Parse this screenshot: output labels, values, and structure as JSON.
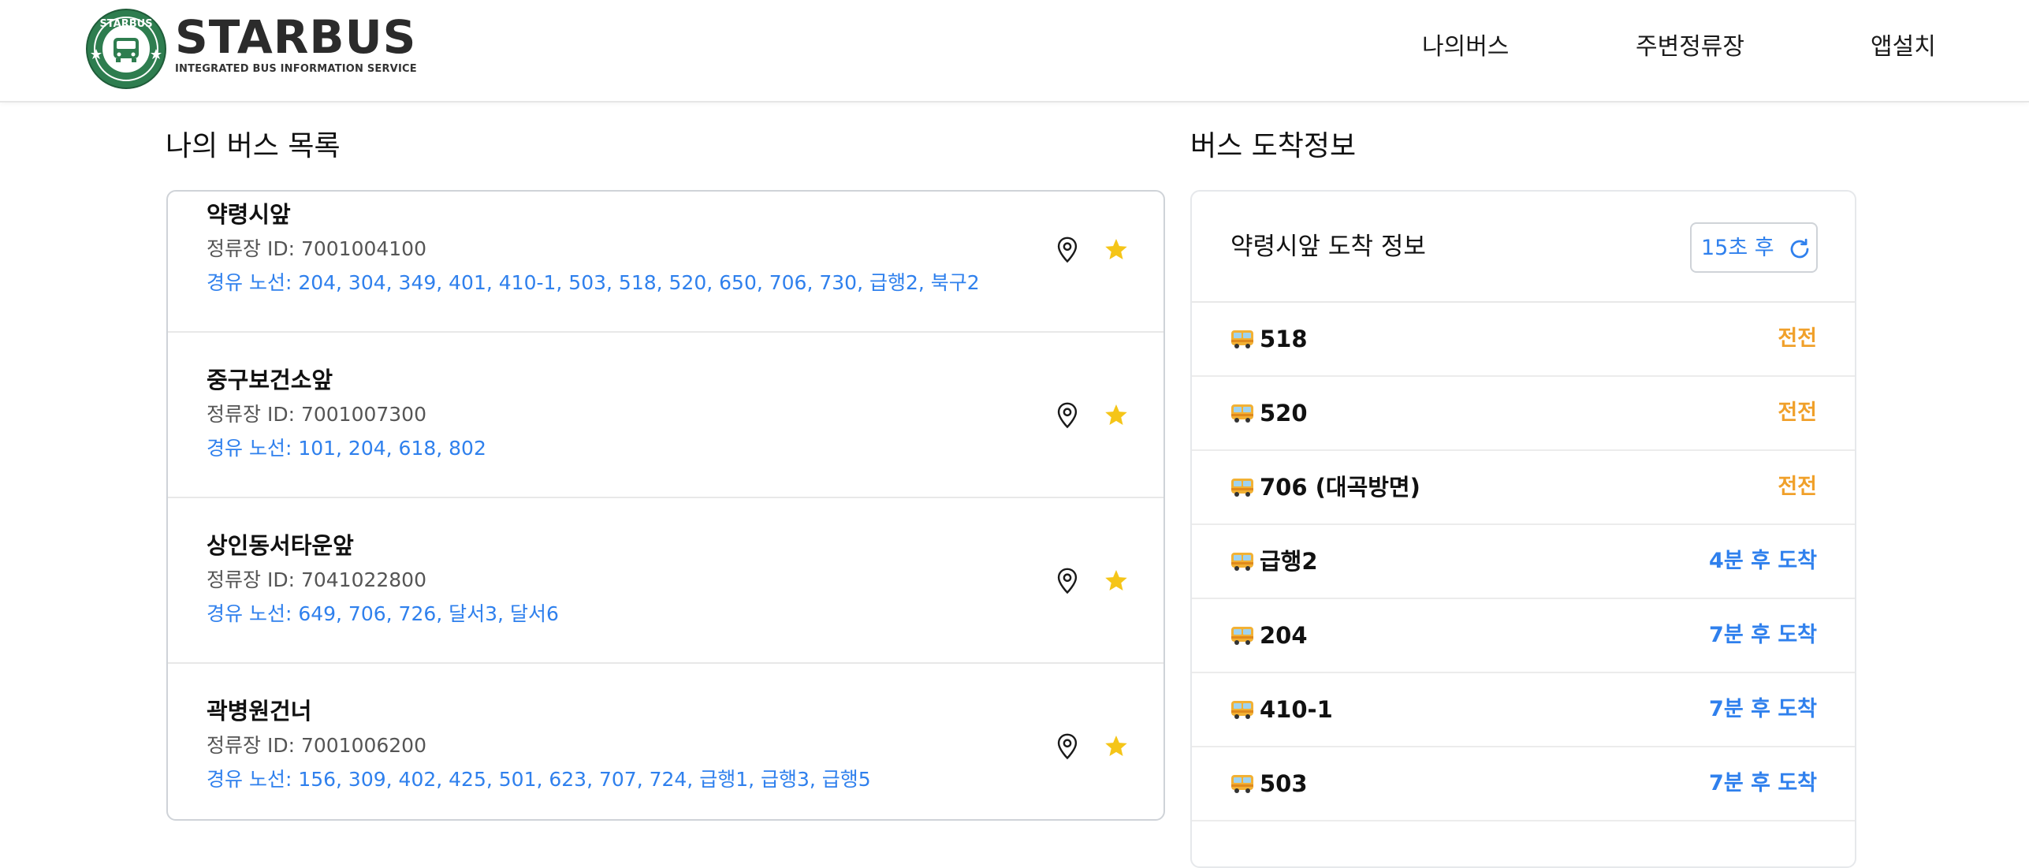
{
  "brand": {
    "name": "STARBUS",
    "tagline": "INTEGRATED BUS INFORMATION SERVICE",
    "logo_text": "STARBUS",
    "primary_color": "#2e7d4f"
  },
  "nav": {
    "items": [
      {
        "label": "나의버스"
      },
      {
        "label": "주변정류장"
      },
      {
        "label": "앱설치"
      }
    ]
  },
  "my_bus_list": {
    "title": "나의 버스 목록",
    "stops": [
      {
        "name": "약령시앞",
        "id_text": "정류장 ID: 7001004100",
        "routes_text": "경유 노선: 204, 304, 349, 401, 410-1, 503, 518, 520, 650, 706, 730, 급행2, 북구2"
      },
      {
        "name": "중구보건소앞",
        "id_text": "정류장 ID: 7001007300",
        "routes_text": "경유 노선: 101, 204, 618, 802"
      },
      {
        "name": "상인동서타운앞",
        "id_text": "정류장 ID: 7041022800",
        "routes_text": "경유 노선: 649, 706, 726, 달서3, 달서6"
      },
      {
        "name": "곽병원건너",
        "id_text": "정류장 ID: 7001006200",
        "routes_text": "경유 노선: 156, 309, 402, 425, 501, 623, 707, 724, 급행1, 급행3, 급행5"
      }
    ],
    "icons": {
      "location": "location-pin-icon",
      "favorite": "star-icon"
    },
    "star_color": "#f5c518"
  },
  "arrival_info": {
    "section_title": "버스 도착정보",
    "card_title": "약령시앞 도착 정보",
    "refresh_label": "15초 후",
    "refresh_icon": "refresh-icon",
    "soon_color": "#f0a02a",
    "later_color": "#2f80ed",
    "rows": [
      {
        "bus": "518",
        "status": "전전",
        "kind": "soon"
      },
      {
        "bus": "520",
        "status": "전전",
        "kind": "soon"
      },
      {
        "bus": "706 (대곡방면)",
        "status": "전전",
        "kind": "soon"
      },
      {
        "bus": "급행2",
        "status": "4분 후 도착",
        "kind": "later"
      },
      {
        "bus": "204",
        "status": "7분 후 도착",
        "kind": "later"
      },
      {
        "bus": "410-1",
        "status": "7분 후 도착",
        "kind": "later"
      },
      {
        "bus": "503",
        "status": "7분 후 도착",
        "kind": "later"
      }
    ]
  }
}
